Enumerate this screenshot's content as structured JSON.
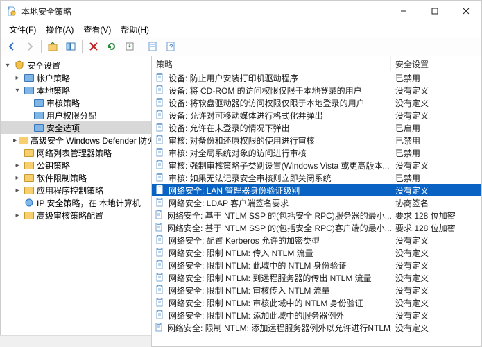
{
  "window": {
    "title": "本地安全策略"
  },
  "menubar": {
    "file": "文件(F)",
    "action": "操作(A)",
    "view": "查看(V)",
    "help": "帮助(H)"
  },
  "list_headers": {
    "policy": "策略",
    "setting": "安全设置"
  },
  "tree": {
    "root": "安全设置",
    "account": "帐户策略",
    "local": "本地策略",
    "audit": "审核策略",
    "rights": "用户权限分配",
    "options": "安全选项",
    "defender": "高级安全 Windows Defender 防火墙",
    "netlist": "网络列表管理器策略",
    "pubkey": "公钥策略",
    "srp": "软件限制策略",
    "appctrl": "应用程序控制策略",
    "ipsec": "IP 安全策略，在 本地计算机",
    "advaudit": "高级审核策略配置"
  },
  "policies": [
    {
      "name": "设备: 防止用户安装打印机驱动程序",
      "val": "已禁用"
    },
    {
      "name": "设备: 将 CD-ROM 的访问权限仅限于本地登录的用户",
      "val": "没有定义"
    },
    {
      "name": "设备: 将软盘驱动器的访问权限仅限于本地登录的用户",
      "val": "没有定义"
    },
    {
      "name": "设备: 允许对可移动媒体进行格式化并弹出",
      "val": "没有定义"
    },
    {
      "name": "设备: 允许在未登录的情况下弹出",
      "val": "已启用"
    },
    {
      "name": "审核: 对备份和还原权限的使用进行审核",
      "val": "已禁用"
    },
    {
      "name": "审核: 对全局系统对象的访问进行审核",
      "val": "已禁用"
    },
    {
      "name": "审核: 强制审核策略子类别设置(Windows Vista 或更高版本...",
      "val": "没有定义"
    },
    {
      "name": "审核: 如果无法记录安全审核则立即关闭系统",
      "val": "已禁用"
    },
    {
      "name": "网络安全: LAN 管理器身份验证级别",
      "val": "没有定义",
      "selected": true
    },
    {
      "name": "网络安全: LDAP 客户端签名要求",
      "val": "协商签名"
    },
    {
      "name": "网络安全: 基于 NTLM SSP 的(包括安全 RPC)服务器的最小...",
      "val": "要求 128 位加密"
    },
    {
      "name": "网络安全: 基于 NTLM SSP 的(包括安全 RPC)客户端的最小...",
      "val": "要求 128 位加密"
    },
    {
      "name": "网络安全: 配置 Kerberos 允许的加密类型",
      "val": "没有定义"
    },
    {
      "name": "网络安全: 限制 NTLM: 传入 NTLM 流量",
      "val": "没有定义"
    },
    {
      "name": "网络安全: 限制 NTLM: 此域中的 NTLM 身份验证",
      "val": "没有定义"
    },
    {
      "name": "网络安全: 限制 NTLM: 到远程服务器的传出 NTLM 流量",
      "val": "没有定义"
    },
    {
      "name": "网络安全: 限制 NTLM: 审核传入 NTLM 流量",
      "val": "没有定义"
    },
    {
      "name": "网络安全: 限制 NTLM: 审核此域中的 NTLM 身份验证",
      "val": "没有定义"
    },
    {
      "name": "网络安全: 限制 NTLM: 添加此域中的服务器例外",
      "val": "没有定义"
    },
    {
      "name": "网络安全: 限制 NTLM: 添加远程服务器例外以允许进行NTLM身份验证",
      "val": "没有定义"
    }
  ]
}
